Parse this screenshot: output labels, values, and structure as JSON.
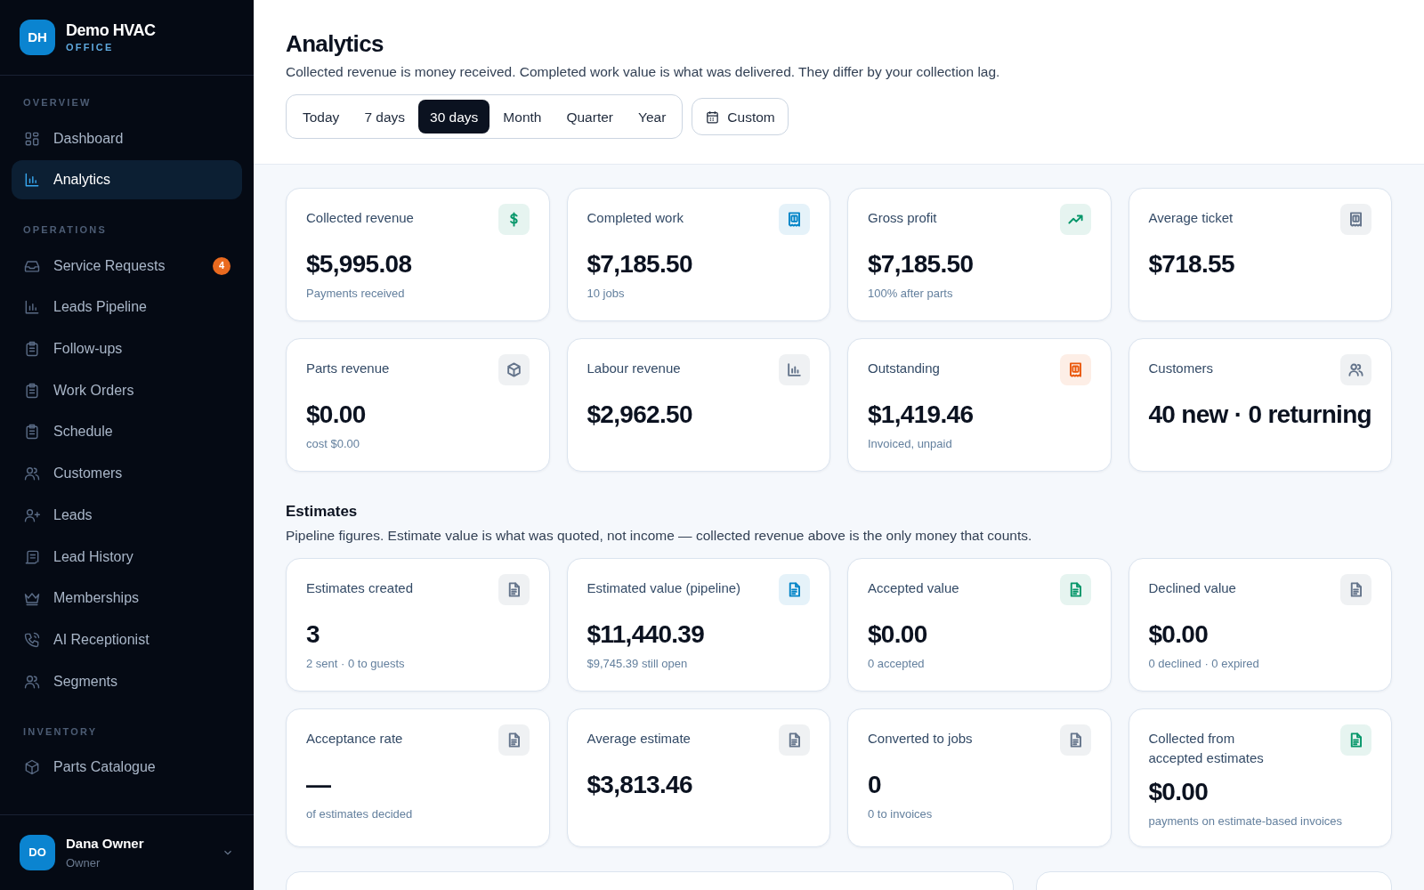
{
  "brand": {
    "initials": "DH",
    "name": "Demo HVAC",
    "subtitle": "OFFICE"
  },
  "sidebar": {
    "sections": [
      {
        "heading": "OVERVIEW",
        "items": [
          {
            "label": "Dashboard",
            "selected": false
          },
          {
            "label": "Analytics",
            "selected": true
          }
        ]
      },
      {
        "heading": "OPERATIONS",
        "items": [
          {
            "label": "Service Requests",
            "selected": false,
            "badge": "4"
          },
          {
            "label": "Leads Pipeline",
            "selected": false
          },
          {
            "label": "Follow-ups",
            "selected": false
          },
          {
            "label": "Work Orders",
            "selected": false
          },
          {
            "label": "Schedule",
            "selected": false
          },
          {
            "label": "Customers",
            "selected": false
          },
          {
            "label": "Leads",
            "selected": false
          },
          {
            "label": "Lead History",
            "selected": false
          },
          {
            "label": "Memberships",
            "selected": false
          },
          {
            "label": "AI Receptionist",
            "selected": false
          },
          {
            "label": "Segments",
            "selected": false
          }
        ]
      },
      {
        "heading": "INVENTORY",
        "items": [
          {
            "label": "Parts Catalogue",
            "selected": false
          }
        ]
      }
    ]
  },
  "user": {
    "initials": "DO",
    "name": "Dana Owner",
    "role": "Owner"
  },
  "page": {
    "title": "Analytics",
    "subtitle": "Collected revenue is money received. Completed work value is what was delivered. They differ by your collection lag."
  },
  "ranges": [
    {
      "label": "Today",
      "selected": false
    },
    {
      "label": "7 days",
      "selected": false
    },
    {
      "label": "30 days",
      "selected": true
    },
    {
      "label": "Month",
      "selected": false
    },
    {
      "label": "Quarter",
      "selected": false
    },
    {
      "label": "Year",
      "selected": false
    }
  ],
  "custom_button": "Custom",
  "metrics": [
    {
      "title": "Collected revenue",
      "value": "$5,995.08",
      "note": "Payments received",
      "color": "#059669"
    },
    {
      "title": "Completed work",
      "value": "$7,185.50",
      "note": "10 jobs",
      "color": "#0284c7"
    },
    {
      "title": "Gross profit",
      "value": "$7,185.50",
      "note": "100% after parts",
      "color": "#059669"
    },
    {
      "title": "Average ticket",
      "value": "$718.55",
      "color": "#64748b"
    },
    {
      "title": "Parts revenue",
      "value": "$0.00",
      "note": "cost $0.00",
      "color": "#64748b"
    },
    {
      "title": "Labour revenue",
      "value": "$2,962.50",
      "color": "#64748b"
    },
    {
      "title": "Outstanding",
      "value": "$1,419.46",
      "note": "Invoiced, unpaid",
      "color": "#ea580c"
    },
    {
      "title": "Customers",
      "value": "40 new · 0 returning",
      "color": "#64748b"
    }
  ],
  "estimates": {
    "title": "Estimates",
    "subtitle": "Pipeline figures. Estimate value is what was quoted, not income — collected revenue above is the only money that counts.",
    "cards": [
      {
        "title": "Estimates created",
        "value": "3",
        "note": "2 sent · 0 to guests",
        "color": "#64748b"
      },
      {
        "title": "Estimated value (pipeline)",
        "value": "$11,440.39",
        "note": "$9,745.39 still open",
        "color": "#0284c7"
      },
      {
        "title": "Accepted value",
        "value": "$0.00",
        "note": "0 accepted",
        "color": "#059669"
      },
      {
        "title": "Declined value",
        "value": "$0.00",
        "note": "0 declined · 0 expired",
        "color": "#64748b"
      },
      {
        "title": "Acceptance rate",
        "value": "—",
        "note": "of estimates decided",
        "color": "#64748b"
      },
      {
        "title": "Average estimate",
        "value": "$3,813.46",
        "color": "#64748b"
      },
      {
        "title": "Converted to jobs",
        "value": "0",
        "note": "0 to invoices",
        "color": "#64748b"
      },
      {
        "title": "Collected from accepted estimates",
        "value": "$0.00",
        "note": "payments on estimate-based invoices",
        "color": "#059669"
      }
    ]
  }
}
